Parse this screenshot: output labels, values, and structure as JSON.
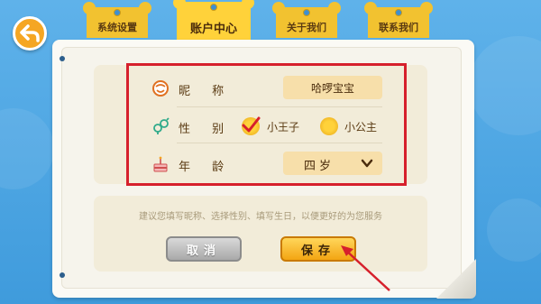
{
  "tabs": [
    {
      "label": "系统设置",
      "active": false
    },
    {
      "label": "账户中心",
      "active": true
    },
    {
      "label": "关于我们",
      "active": false
    },
    {
      "label": "联系我们",
      "active": false
    }
  ],
  "form": {
    "nickname": {
      "label": "昵 称",
      "value": "哈啰宝宝"
    },
    "gender": {
      "label": "性 别",
      "options": [
        {
          "label": "小王子",
          "selected": true
        },
        {
          "label": "小公主",
          "selected": false
        }
      ]
    },
    "age": {
      "label": "年 龄",
      "value": "四岁"
    }
  },
  "hint": "建议您填写昵称、选择性别、填写生日，以便更好的为您服务",
  "buttons": {
    "cancel": "取消",
    "save": "保存"
  },
  "colors": {
    "accent": "#f2c230",
    "highlight": "#d6202c",
    "background": "#4aa3e0"
  }
}
